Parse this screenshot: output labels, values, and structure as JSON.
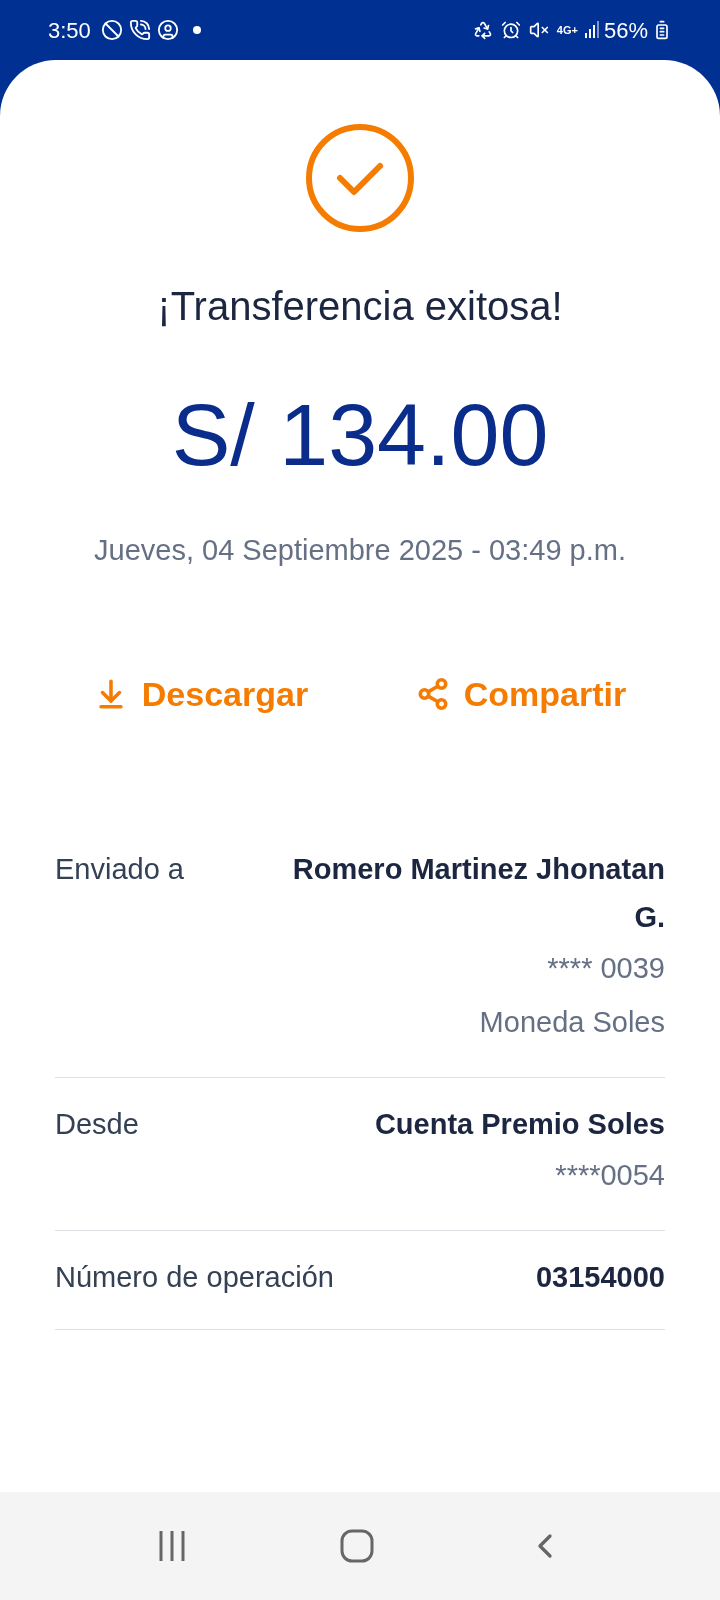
{
  "status_bar": {
    "time": "3:50",
    "network": "4G+",
    "battery": "56%"
  },
  "result": {
    "title": "¡Transferencia exitosa!",
    "amount": "S/ 134.00",
    "datetime": "Jueves, 04 Septiembre 2025 - 03:49 p.m."
  },
  "actions": [
    {
      "kind": "download",
      "label": "Descargar"
    },
    {
      "kind": "share",
      "label": "Compartir"
    }
  ],
  "details": [
    {
      "label": "Enviado a",
      "lines": [
        {
          "text": "Romero Martinez Jhonatan G.",
          "bold": true
        },
        {
          "text": "**** 0039",
          "bold": false
        },
        {
          "text": "Moneda Soles",
          "bold": false
        }
      ]
    },
    {
      "label": "Desde",
      "lines": [
        {
          "text": "Cuenta Premio Soles",
          "bold": true
        },
        {
          "text": "****0054",
          "bold": false
        }
      ]
    },
    {
      "label": "Número de operación",
      "lines": [
        {
          "text": "03154000",
          "bold": true
        }
      ]
    }
  ]
}
